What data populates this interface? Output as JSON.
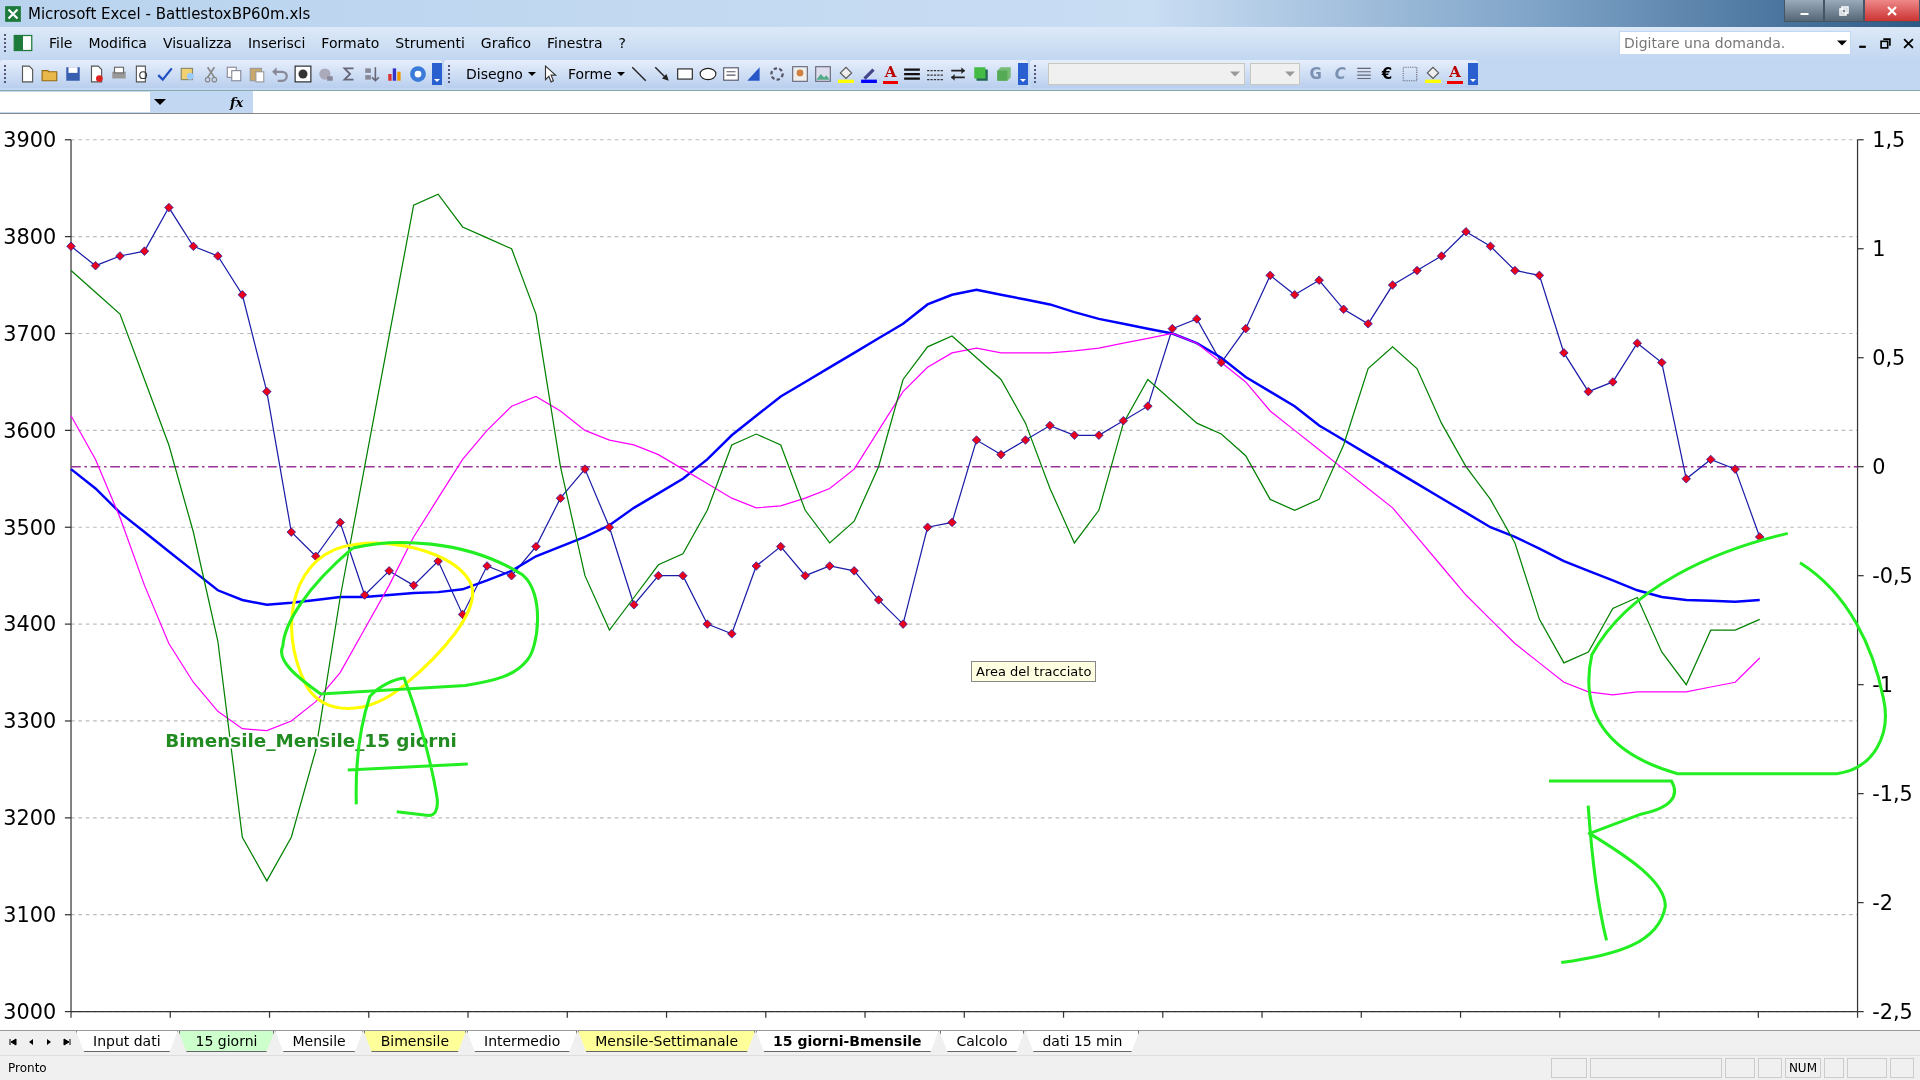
{
  "window": {
    "title": "Microsoft Excel - BattlestoxBP60m.xls"
  },
  "menu": [
    "File",
    "Modifica",
    "Visualizza",
    "Inserisci",
    "Formato",
    "Strumenti",
    "Grafico",
    "Finestra",
    "?"
  ],
  "help_search": {
    "placeholder": "Digitare una domanda."
  },
  "toolbar": {
    "drawing_menu": "Disegno",
    "shapes_menu": "Forme",
    "bold": "G",
    "italic": "C",
    "currency": "€",
    "font_color_buttons": [
      "A",
      "A"
    ]
  },
  "formula_bar": {
    "function_label": "fx"
  },
  "chart": {
    "tooltip": "Area del tracciato",
    "chart_data": {
      "type": "line",
      "grid": true,
      "ylim": [
        3000,
        3900
      ],
      "yticks": [
        3000,
        3100,
        3200,
        3300,
        3400,
        3500,
        3600,
        3700,
        3800,
        3900
      ],
      "y2lim": [
        -2.5,
        1.5
      ],
      "y2ticks": [
        {
          "value": 1.5,
          "label": "1,5"
        },
        {
          "value": 1,
          "label": "1"
        },
        {
          "value": 0.5,
          "label": "0,5"
        },
        {
          "value": 0,
          "label": "0"
        },
        {
          "value": -0.5,
          "label": "-0,5"
        },
        {
          "value": -1,
          "label": "-1"
        },
        {
          "value": -1.5,
          "label": "-1,5"
        },
        {
          "value": -2,
          "label": "-2"
        },
        {
          "value": -2.5,
          "label": "-2,5"
        }
      ],
      "series": [
        {
          "color": "#1c1ca8",
          "marker": "diamond",
          "values": [
            3790,
            3770,
            3780,
            3785,
            3830,
            3790,
            3780,
            3740,
            3640,
            3495,
            3470,
            3505,
            3430,
            3455,
            3440,
            3465,
            3410,
            3460,
            3450,
            3480,
            3530,
            3560,
            3500,
            3420,
            3450,
            3450,
            3400,
            3390,
            3460,
            3480,
            3450,
            3460,
            3455,
            3425,
            3400,
            3500,
            3505,
            3590,
            3575,
            3590,
            3605,
            3595,
            3595,
            3610,
            3625,
            3705,
            3715,
            3670,
            3705,
            3760,
            3740,
            3755,
            3725,
            3710,
            3750,
            3765,
            3780,
            3805,
            3790,
            3765,
            3760,
            3680,
            3640,
            3650,
            3690,
            3670,
            3550,
            3570,
            3560,
            3490,
            null,
            null,
            null,
            null
          ]
        },
        {
          "color": "#0000ff",
          "values": [
            3560,
            3540,
            3515,
            3495,
            3475,
            3455,
            3435,
            3425,
            3420,
            3422,
            3425,
            3428,
            3428,
            3430,
            3432,
            3433,
            3436,
            3445,
            3455,
            3470,
            3480,
            3490,
            3502,
            3520,
            3535,
            3550,
            3570,
            3595,
            3615,
            3635,
            3650,
            3665,
            3680,
            3695,
            3710,
            3730,
            3740,
            3745,
            3740,
            3735,
            3730,
            3722,
            3715,
            3710,
            3705,
            3700,
            3690,
            3675,
            3655,
            3640,
            3625,
            3605,
            3590,
            3575,
            3560,
            3545,
            3530,
            3515,
            3500,
            3490,
            3478,
            3465,
            3455,
            3445,
            3435,
            3428,
            3425,
            3424,
            3423,
            3425,
            null,
            null,
            null,
            null
          ]
        },
        {
          "color": "#ff00ff",
          "values": [
            3615,
            3570,
            3510,
            3440,
            3380,
            3340,
            3310,
            3292,
            3290,
            3300,
            3320,
            3350,
            3395,
            3440,
            3490,
            3530,
            3570,
            3600,
            3625,
            3635,
            3620,
            3600,
            3590,
            3585,
            3575,
            3560,
            3545,
            3530,
            3520,
            3522,
            3530,
            3540,
            3560,
            3600,
            3640,
            3665,
            3680,
            3685,
            3680,
            3680,
            3680,
            3682,
            3685,
            3690,
            3695,
            3700,
            3690,
            3670,
            3650,
            3620,
            3600,
            3580,
            3560,
            3540,
            3520,
            3490,
            3460,
            3430,
            3405,
            3380,
            3360,
            3340,
            3330,
            3327,
            3330,
            3330,
            3330,
            3335,
            3340,
            3365,
            null,
            null,
            null,
            null
          ]
        },
        {
          "color": "#008000",
          "axis": "y2",
          "values": [
            0.9,
            0.8,
            0.7,
            0.4,
            0.1,
            -0.3,
            -0.8,
            -1.7,
            -1.9,
            -1.7,
            -1.3,
            -0.6,
            0,
            0.6,
            1.2,
            1.25,
            1.1,
            1.05,
            1,
            0.7,
            0,
            -0.5,
            -0.75,
            -0.6,
            -0.45,
            -0.4,
            -0.2,
            0.1,
            0.15,
            0.1,
            -0.2,
            -0.35,
            -0.25,
            0,
            0.4,
            0.55,
            0.6,
            0.5,
            0.4,
            0.2,
            -0.1,
            -0.35,
            -0.2,
            0.2,
            0.4,
            0.3,
            0.2,
            0.15,
            0.05,
            -0.15,
            -0.2,
            -0.15,
            0.1,
            0.45,
            0.55,
            0.45,
            0.2,
            0,
            -0.15,
            -0.35,
            -0.7,
            -0.9,
            -0.85,
            -0.65,
            -0.6,
            -0.85,
            -1,
            -0.75,
            -0.75,
            -0.7,
            null,
            null,
            null,
            null
          ]
        }
      ],
      "ref_lines": [
        {
          "axis": "y2",
          "value": 0
        }
      ],
      "annotations": [
        {
          "text": "Bimensile_Mensile_15 giorni"
        }
      ]
    }
  },
  "sheet_tabs": [
    {
      "label": "Input dati",
      "selected": false,
      "color": "#ffffff"
    },
    {
      "label": "15 giorni",
      "selected": false,
      "color": "#ccffcc"
    },
    {
      "label": "Mensile",
      "selected": false,
      "color": "#ffffff"
    },
    {
      "label": "Bimensile",
      "selected": false,
      "color": "#ffff99"
    },
    {
      "label": "Intermedio",
      "selected": false,
      "color": "#ffffff"
    },
    {
      "label": "Mensile-Settimanale",
      "selected": false,
      "color": "#ffff99"
    },
    {
      "label": "15 giorni-Bmensile",
      "selected": true,
      "color": "#ffffff"
    },
    {
      "label": "Calcolo",
      "selected": false,
      "color": "#ffffff"
    },
    {
      "label": "dati 15 min",
      "selected": false,
      "color": "#ffffff"
    }
  ],
  "status_bar": {
    "text": "Pronto",
    "indicator": "NUM"
  }
}
